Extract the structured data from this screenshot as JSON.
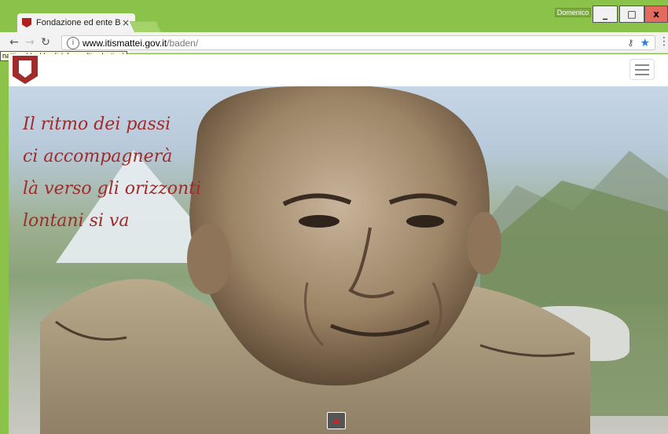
{
  "browser": {
    "tab_title": "Fondazione ed ente Bade",
    "tab_close": "×",
    "user_name": "Domenico",
    "window_minimize": "_",
    "window_maximize": "□",
    "window_close": "x",
    "url_host": "www.itismattei.gov.it",
    "url_path": "/baden/",
    "tooltip": "natting (double click for multi-selection)",
    "icons": [
      "back-arrow-icon",
      "forward-arrow-icon",
      "reload-icon",
      "info-icon",
      "key-icon",
      "star-icon",
      "menu-dots-icon"
    ]
  },
  "page": {
    "quote_lines": [
      "Il ritmo dei passi",
      "ci accompagnerà",
      "là verso gli orizzonti",
      "lontani si va"
    ],
    "accent_color": "#a12a2a"
  }
}
